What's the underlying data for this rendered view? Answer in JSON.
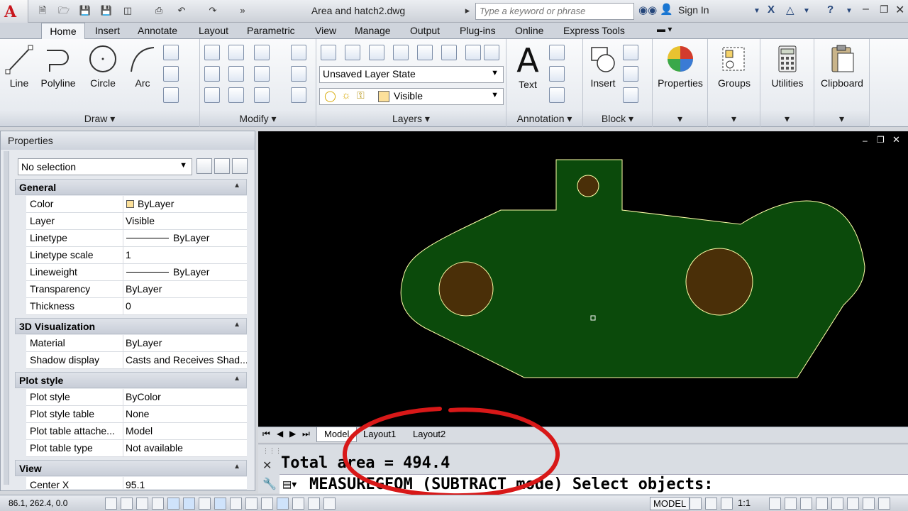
{
  "window": {
    "title": "Area and hatch2.dwg",
    "search_placeholder": "Type a keyword or phrase",
    "sign_in": "Sign In",
    "app_logo": "A"
  },
  "ribbon_tabs": [
    "Home",
    "Insert",
    "Annotate",
    "Layout",
    "Parametric",
    "View",
    "Manage",
    "Output",
    "Plug-ins",
    "Online",
    "Express Tools"
  ],
  "ribbon": {
    "draw": {
      "title": "Draw",
      "tools": [
        "Line",
        "Polyline",
        "Circle",
        "Arc"
      ]
    },
    "modify": {
      "title": "Modify"
    },
    "layers": {
      "title": "Layers",
      "layer_state": "Unsaved Layer State",
      "current_layer": "Visible"
    },
    "annotation": {
      "title": "Annotation",
      "text": "Text"
    },
    "block": {
      "title": "Block",
      "insert": "Insert"
    },
    "properties": "Properties",
    "groups": "Groups",
    "utilities": "Utilities",
    "clipboard": "Clipboard"
  },
  "properties_palette": {
    "title": "Properties",
    "selection": "No selection",
    "sections": {
      "general": {
        "title": "General",
        "rows": [
          {
            "k": "Color",
            "v": "ByLayer"
          },
          {
            "k": "Layer",
            "v": "Visible"
          },
          {
            "k": "Linetype",
            "v": "ByLayer"
          },
          {
            "k": "Linetype scale",
            "v": "1"
          },
          {
            "k": "Lineweight",
            "v": "ByLayer"
          },
          {
            "k": "Transparency",
            "v": "ByLayer"
          },
          {
            "k": "Thickness",
            "v": "0"
          }
        ]
      },
      "viz3d": {
        "title": "3D Visualization",
        "rows": [
          {
            "k": "Material",
            "v": "ByLayer"
          },
          {
            "k": "Shadow display",
            "v": "Casts and Receives Shad..."
          }
        ]
      },
      "plotstyle": {
        "title": "Plot style",
        "rows": [
          {
            "k": "Plot style",
            "v": "ByColor"
          },
          {
            "k": "Plot style table",
            "v": "None"
          },
          {
            "k": "Plot table attache...",
            "v": "Model"
          },
          {
            "k": "Plot table type",
            "v": "Not available"
          }
        ]
      },
      "view": {
        "title": "View",
        "partial_row": {
          "k": "Center X",
          "v": "95.1"
        }
      }
    }
  },
  "layout_tabs": [
    "Model",
    "Layout1",
    "Layout2"
  ],
  "command": {
    "history": "Total area = 494.4",
    "prompt": "MEASUREGEOM (SUBTRACT mode) Select objects:"
  },
  "status_bar": {
    "coords": "86.1, 262.4, 0.0",
    "model": "MODEL",
    "scale": "1:1"
  },
  "colors": {
    "hatch_fill": "#0b4a0b",
    "hole_fill": "#4a2f08",
    "boundary": "#ffffaa",
    "annotation_ellipse": "#d81818"
  }
}
